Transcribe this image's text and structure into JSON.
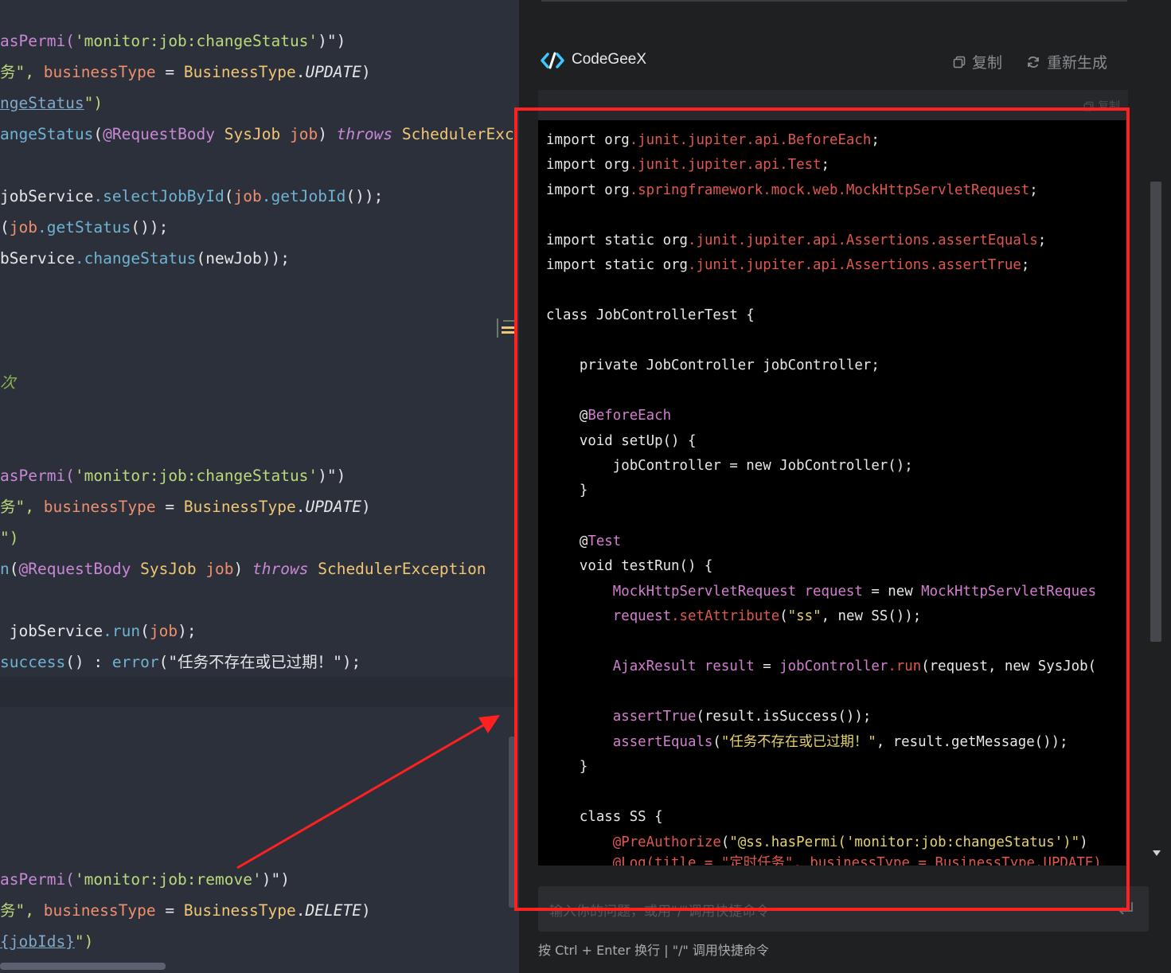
{
  "editor": {
    "lines": [
      [
        {
          "t": "asPermi(",
          "c": "#c888d6"
        },
        {
          "t": "'monitor:job:changeStatus'",
          "c": "#b9d97a"
        },
        {
          "t": ")\")",
          "c": "#e6e6e6"
        }
      ],
      [
        {
          "t": "务\", ",
          "c": "#b9d97a"
        },
        {
          "t": "businessType",
          "c": "#ef8f6e"
        },
        {
          "t": " = ",
          "c": "#e6e6e6"
        },
        {
          "t": "BusinessType",
          "c": "#f0c674"
        },
        {
          "t": ".",
          "c": "#e6e6e6"
        },
        {
          "t": "UPDATE",
          "c": "#e6e6e6",
          "i": true
        },
        {
          "t": ")",
          "c": "#e6e6e6"
        }
      ],
      [
        {
          "t": "ngeStatus",
          "c": "#7fa8c9",
          "u": true
        },
        {
          "t": "\")",
          "c": "#b9d97a"
        }
      ],
      [
        {
          "t": "angeStatus",
          "c": "#6fb3d2"
        },
        {
          "t": "(",
          "c": "#e6e6e6"
        },
        {
          "t": "@RequestBody",
          "c": "#c888d6"
        },
        {
          "t": " SysJob ",
          "c": "#f0c674"
        },
        {
          "t": "job",
          "c": "#ef8f6e"
        },
        {
          "t": ") ",
          "c": "#e6e6e6"
        },
        {
          "t": "throws",
          "c": "#c888d6",
          "i": true
        },
        {
          "t": " SchedulerExc",
          "c": "#f0c674"
        }
      ],
      [
        {
          "t": "jobService",
          "c": "#e6e6e6"
        },
        {
          "t": ".selectJobById",
          "c": "#6fb3d2"
        },
        {
          "t": "(",
          "c": "#e6e6e6"
        },
        {
          "t": "job",
          "c": "#ef8f6e"
        },
        {
          "t": ".getJobId",
          "c": "#6fb3d2"
        },
        {
          "t": "());",
          "c": "#e6e6e6"
        }
      ],
      [
        {
          "t": "(",
          "c": "#e6e6e6"
        },
        {
          "t": "job",
          "c": "#ef8f6e"
        },
        {
          "t": ".getStatus",
          "c": "#6fb3d2"
        },
        {
          "t": "());",
          "c": "#e6e6e6"
        }
      ],
      [
        {
          "t": "bService",
          "c": "#e6e6e6"
        },
        {
          "t": ".changeStatus",
          "c": "#6fb3d2"
        },
        {
          "t": "(newJob));",
          "c": "#e6e6e6"
        }
      ],
      [
        {
          "t": "次",
          "c": "#8bb155",
          "i": true
        }
      ],
      [
        {
          "t": "asPermi(",
          "c": "#c888d6"
        },
        {
          "t": "'monitor:job:changeStatus'",
          "c": "#b9d97a"
        },
        {
          "t": ")\")",
          "c": "#e6e6e6"
        }
      ],
      [
        {
          "t": "务\", ",
          "c": "#b9d97a"
        },
        {
          "t": "businessType",
          "c": "#ef8f6e"
        },
        {
          "t": " = ",
          "c": "#e6e6e6"
        },
        {
          "t": "BusinessType",
          "c": "#f0c674"
        },
        {
          "t": ".",
          "c": "#e6e6e6"
        },
        {
          "t": "UPDATE",
          "c": "#e6e6e6",
          "i": true
        },
        {
          "t": ")",
          "c": "#e6e6e6"
        }
      ],
      [
        {
          "t": "\")",
          "c": "#b9d97a"
        }
      ],
      [
        {
          "t": "n",
          "c": "#6fb3d2"
        },
        {
          "t": "(",
          "c": "#e6e6e6"
        },
        {
          "t": "@RequestBody",
          "c": "#c888d6"
        },
        {
          "t": " SysJob ",
          "c": "#f0c674"
        },
        {
          "t": "job",
          "c": "#ef8f6e"
        },
        {
          "t": ") ",
          "c": "#e6e6e6"
        },
        {
          "t": "throws",
          "c": "#c888d6",
          "i": true
        },
        {
          "t": " SchedulerException",
          "c": "#f0c674"
        }
      ],
      [
        {
          "t": " jobService",
          "c": "#e6e6e6"
        },
        {
          "t": ".run",
          "c": "#6fb3d2"
        },
        {
          "t": "(",
          "c": "#e6e6e6"
        },
        {
          "t": "job",
          "c": "#ef8f6e"
        },
        {
          "t": ");",
          "c": "#e6e6e6"
        }
      ],
      [
        {
          "t": "success",
          "c": "#6fb3d2"
        },
        {
          "t": "() : ",
          "c": "#e6e6e6"
        },
        {
          "t": "error",
          "c": "#6fb3d2"
        },
        {
          "t": "(\"任务不存在或已过期！\");",
          "c": "#e6e6e6"
        }
      ],
      [
        {
          "t": "asPermi(",
          "c": "#c888d6"
        },
        {
          "t": "'monitor:job:remove'",
          "c": "#b9d97a"
        },
        {
          "t": ")\")",
          "c": "#e6e6e6"
        }
      ],
      [
        {
          "t": "务\", ",
          "c": "#b9d97a"
        },
        {
          "t": "businessType",
          "c": "#ef8f6e"
        },
        {
          "t": " = ",
          "c": "#e6e6e6"
        },
        {
          "t": "BusinessType",
          "c": "#f0c674"
        },
        {
          "t": ".",
          "c": "#e6e6e6"
        },
        {
          "t": "DELETE",
          "c": "#e6e6e6",
          "i": true
        },
        {
          "t": ")",
          "c": "#e6e6e6"
        }
      ],
      [
        {
          "t": "{jobIds}",
          "c": "#7fa8c9",
          "u": true
        },
        {
          "t": "\")",
          "c": "#b9d97a"
        }
      ]
    ]
  },
  "panel": {
    "brand": "CodeGeeX",
    "copy_label": "复制",
    "regenerate_label": "重新生成",
    "snippet_copy_label": "复制",
    "input_placeholder": "输入你的问题，或用\"/\"调用快捷命令",
    "hint": "按 Ctrl + Enter 换行 | \"/\" 调用快捷命令",
    "code": [
      [
        {
          "t": "import org",
          "c": "#e8e8e8"
        },
        {
          "t": ".junit.jupiter.api.BeforeEach",
          "c": "#e0574f"
        },
        {
          "t": ";",
          "c": "#e8e8e8"
        }
      ],
      [
        {
          "t": "import org",
          "c": "#e8e8e8"
        },
        {
          "t": ".junit.jupiter.api.Test",
          "c": "#e0574f"
        },
        {
          "t": ";",
          "c": "#e8e8e8"
        }
      ],
      [
        {
          "t": "import org",
          "c": "#e8e8e8"
        },
        {
          "t": ".springframework.mock.web.MockHttpServletRequest",
          "c": "#e0574f"
        },
        {
          "t": ";",
          "c": "#e8e8e8"
        }
      ],
      [
        {
          "t": "import static org",
          "c": "#e8e8e8"
        },
        {
          "t": ".junit.jupiter.api.Assertions.assertEquals",
          "c": "#e0574f"
        },
        {
          "t": ";",
          "c": "#e8e8e8"
        }
      ],
      [
        {
          "t": "import static org",
          "c": "#e8e8e8"
        },
        {
          "t": ".junit.jupiter.api.Assertions.assertTrue",
          "c": "#e0574f"
        },
        {
          "t": ";",
          "c": "#e8e8e8"
        }
      ],
      [
        {
          "t": "class JobControllerTest {",
          "c": "#e8e8e8"
        }
      ],
      [
        {
          "t": "    private JobController jobController;",
          "c": "#e8e8e8"
        }
      ],
      [
        {
          "t": "    @",
          "c": "#e8e8e8"
        },
        {
          "t": "BeforeEach",
          "c": "#d37fd0"
        }
      ],
      [
        {
          "t": "    void setUp() {",
          "c": "#e8e8e8"
        }
      ],
      [
        {
          "t": "        jobController = new JobController();",
          "c": "#e8e8e8"
        }
      ],
      [
        {
          "t": "    }",
          "c": "#e8e8e8"
        }
      ],
      [
        {
          "t": "    @",
          "c": "#e8e8e8"
        },
        {
          "t": "Test",
          "c": "#d37fd0"
        }
      ],
      [
        {
          "t": "    void testRun() {",
          "c": "#e8e8e8"
        }
      ],
      [
        {
          "t": "        MockHttpServletRequest request",
          "c": "#d37fd0"
        },
        {
          "t": " = new ",
          "c": "#e8e8e8"
        },
        {
          "t": "MockHttpServletReques",
          "c": "#d37fd0"
        }
      ],
      [
        {
          "t": "        request",
          "c": "#d37fd0"
        },
        {
          "t": ".setAttribute",
          "c": "#e0574f"
        },
        {
          "t": "(",
          "c": "#e8e8e8"
        },
        {
          "t": "\"ss\"",
          "c": "#e6d36b"
        },
        {
          "t": ", new SS());",
          "c": "#e8e8e8"
        }
      ],
      [
        {
          "t": "        AjaxResult result",
          "c": "#d37fd0"
        },
        {
          "t": " = ",
          "c": "#e8e8e8"
        },
        {
          "t": "jobController",
          "c": "#d37fd0"
        },
        {
          "t": ".run",
          "c": "#e0574f"
        },
        {
          "t": "(request, new SysJob(",
          "c": "#e8e8e8"
        }
      ],
      [
        {
          "t": "        assertTrue",
          "c": "#d37fd0"
        },
        {
          "t": "(result.isSuccess());",
          "c": "#e8e8e8"
        }
      ],
      [
        {
          "t": "        assertEquals",
          "c": "#d37fd0"
        },
        {
          "t": "(",
          "c": "#e8e8e8"
        },
        {
          "t": "\"任务不存在或已过期！\"",
          "c": "#e6d36b"
        },
        {
          "t": ", result.getMessage());",
          "c": "#e8e8e8"
        }
      ],
      [
        {
          "t": "    }",
          "c": "#e8e8e8"
        }
      ],
      [
        {
          "t": "    class SS {",
          "c": "#e8e8e8"
        }
      ],
      [
        {
          "t": "        @PreAuthorize",
          "c": "#e0574f"
        },
        {
          "t": "(",
          "c": "#e8e8e8"
        },
        {
          "t": "\"@ss.hasPermi('monitor:job:changeStatus')\"",
          "c": "#e6d36b"
        },
        {
          "t": ")",
          "c": "#e8e8e8"
        }
      ],
      [
        {
          "t": "        @Log(title = \"定时任务\", businessType = BusinessType.UPDATE)",
          "c": "#e0574f"
        }
      ]
    ]
  },
  "colors": {
    "annotation_red": "#ff2020",
    "panel_bg": "#1f2022",
    "editor_bg": "#2b303b"
  }
}
